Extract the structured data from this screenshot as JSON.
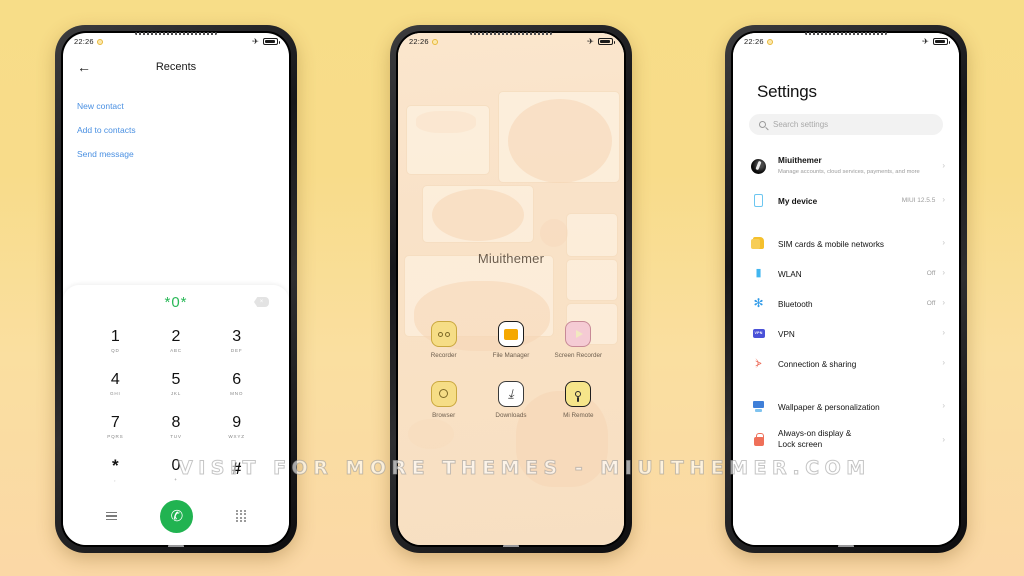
{
  "watermark": "VISIT FOR MORE THEMES - MIUITHEMER.COM",
  "status_bar": {
    "time": "22:26"
  },
  "dialer": {
    "title": "Recents",
    "back_icon": "←",
    "links": [
      "New contact",
      "Add to contacts",
      "Send message"
    ],
    "dialed_number": "*0*",
    "keys": [
      {
        "num": "1",
        "sub": "QD"
      },
      {
        "num": "2",
        "sub": "ABC"
      },
      {
        "num": "3",
        "sub": "DEF"
      },
      {
        "num": "4",
        "sub": "GHI"
      },
      {
        "num": "5",
        "sub": "JKL"
      },
      {
        "num": "6",
        "sub": "MNO"
      },
      {
        "num": "7",
        "sub": "PQRS"
      },
      {
        "num": "8",
        "sub": "TUV"
      },
      {
        "num": "9",
        "sub": "WXYZ"
      },
      {
        "num": "*",
        "sub": ","
      },
      {
        "num": "0",
        "sub": "+"
      },
      {
        "num": "#",
        "sub": ""
      }
    ],
    "call_icon": "✆"
  },
  "home": {
    "label": "Miuithemer",
    "apps": [
      {
        "name": "Recorder",
        "icon": "recorder-icon"
      },
      {
        "name": "File Manager",
        "icon": "file-manager-icon"
      },
      {
        "name": "Screen Recorder",
        "icon": "screen-recorder-icon"
      },
      {
        "name": "Browser",
        "icon": "browser-icon"
      },
      {
        "name": "Downloads",
        "icon": "downloads-icon"
      },
      {
        "name": "Mi Remote",
        "icon": "mi-remote-icon"
      }
    ],
    "downloads_glyph": "⤓"
  },
  "settings": {
    "title": "Settings",
    "search_placeholder": "Search settings",
    "account": {
      "name": "Miuithemer",
      "subtitle": "Manage accounts, cloud services, payments, and more"
    },
    "rows": [
      {
        "label": "My device",
        "value": "MIUI 12.5.5",
        "icon": "device-icon"
      },
      {
        "label": "SIM cards & mobile networks",
        "value": "",
        "icon": "sim-icon"
      },
      {
        "label": "WLAN",
        "value": "Off",
        "icon": "wifi-icon"
      },
      {
        "label": "Bluetooth",
        "value": "Off",
        "icon": "bluetooth-icon"
      },
      {
        "label": "VPN",
        "value": "",
        "icon": "vpn-icon"
      },
      {
        "label": "Connection & sharing",
        "value": "",
        "icon": "connection-sharing-icon"
      },
      {
        "label": "Wallpaper & personalization",
        "value": "",
        "icon": "wallpaper-icon"
      },
      {
        "label": "Always-on display & Lock screen",
        "value": "",
        "icon": "lock-icon"
      }
    ],
    "vpn_badge": "VPN",
    "chevron": "›"
  },
  "colors": {
    "accent_green": "#21b351",
    "link_blue": "#4a90e2",
    "bg_top": "#f7dd88",
    "bg_bottom": "#fbd8a6"
  }
}
